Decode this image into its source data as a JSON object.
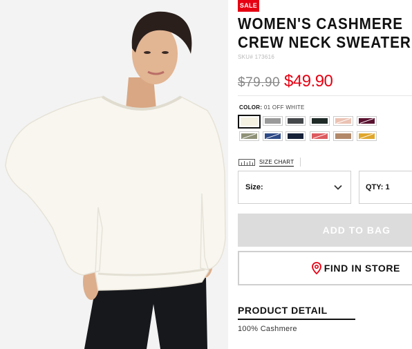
{
  "product": {
    "badge": "SALE",
    "title_line1": "WOMEN'S CASHMERE",
    "title_line2": "CREW NECK SWEATER",
    "sku": "SKU# 173616",
    "price_original": "$79.90",
    "price_sale": "$49.90"
  },
  "color": {
    "label": "COLOR:",
    "selected_value": "01 OFF WHITE",
    "swatches": [
      {
        "name": "off-white",
        "hex": "#f4f0e2",
        "selected": true
      },
      {
        "name": "gray",
        "hex": "#9a9a9a",
        "selected": false
      },
      {
        "name": "dark-gray",
        "hex": "#45484b",
        "selected": false
      },
      {
        "name": "dark-green",
        "hex": "#1f2a27",
        "selected": false
      },
      {
        "name": "pink-beige",
        "hex": "#ebc2b3",
        "selected": false
      },
      {
        "name": "wine",
        "hex": "#5a1230",
        "selected": false
      },
      {
        "name": "olive",
        "hex": "#8f9278",
        "selected": false
      },
      {
        "name": "blue",
        "hex": "#2e4a86",
        "selected": false
      },
      {
        "name": "navy",
        "hex": "#162138",
        "selected": false
      },
      {
        "name": "coral",
        "hex": "#dc5b5f",
        "selected": false
      },
      {
        "name": "camel",
        "hex": "#b2896a",
        "selected": false
      },
      {
        "name": "mustard",
        "hex": "#e0a72c",
        "selected": false
      }
    ]
  },
  "size_chart": {
    "label": "SIZE CHART",
    "icon": "ruler-icon"
  },
  "size_select": {
    "label": "Size:",
    "icon": "chevron-down-icon"
  },
  "qty_select": {
    "label": "QTY: 1"
  },
  "buttons": {
    "add_to_bag": "ADD TO BAG",
    "find_in_store": "FIND IN STORE",
    "find_icon": "location-pin-icon"
  },
  "detail": {
    "heading": "PRODUCT DETAIL",
    "material": "100% Cashmere"
  },
  "colors": {
    "accent_red": "#e60012",
    "disabled_button": "#dcdcdc"
  }
}
